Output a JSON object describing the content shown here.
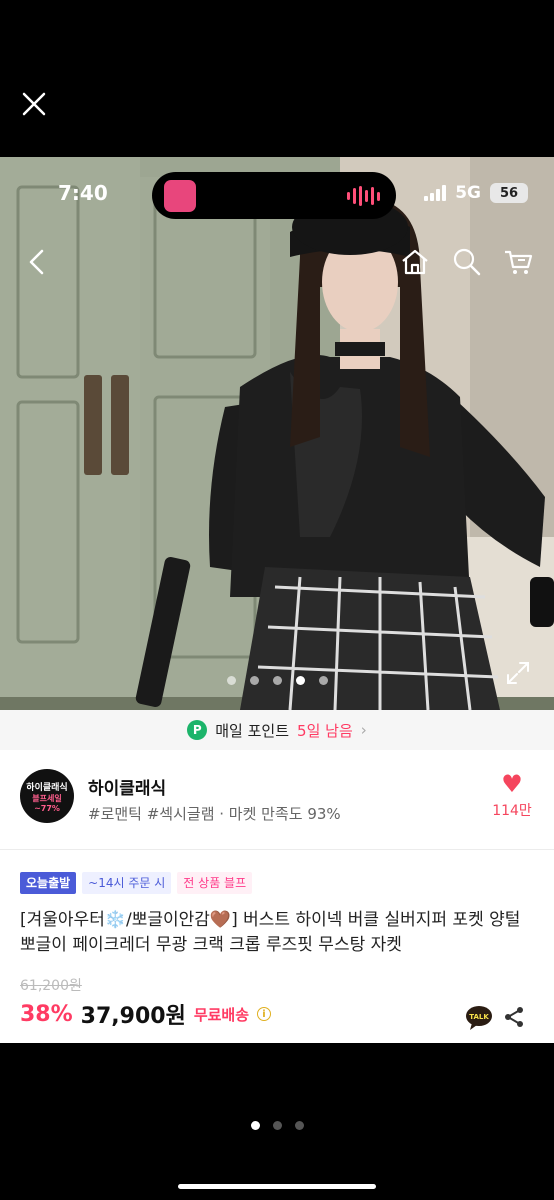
{
  "status_bar": {
    "time": "7:40",
    "network": "5G",
    "battery": "56"
  },
  "colors": {
    "brand_pink": "#ff3b63",
    "points_green": "#1cb46a",
    "badge_blue": "#4b5bd8"
  },
  "icons": {
    "close": "close-icon",
    "back": "chevron-left-icon",
    "home": "home-icon",
    "search": "search-icon",
    "cart": "cart-icon",
    "expand": "expand-icon",
    "heart": "heart-icon",
    "talk": "kakaotalk-icon",
    "share": "share-icon"
  },
  "photo": {
    "slide_count": 5,
    "active_slide": 4
  },
  "points_bar": {
    "icon_letter": "P",
    "label": "매일 포인트",
    "highlight": "5일 남음",
    "arrow": "›"
  },
  "seller": {
    "logo": {
      "line1": "하이클래식",
      "line2": "블프세일",
      "line3": "~77%"
    },
    "name": "하이클래식",
    "tags": "#로맨틱 #섹시글램 · 마켓 만족도 93%",
    "likes": "114만"
  },
  "product": {
    "badges": [
      "오늘출발",
      "~14시 주문 시",
      "전 상품 블프"
    ],
    "title": "[겨울아우터❄️/뽀글이안감🤎] 버스트 하이넥 버클 실버지퍼 포켓 양털 뽀글이 페이크레더 무광 크랙 크롭 루즈핏 무스탕 자켓",
    "original_price": "61,200원",
    "discount": "38%",
    "price": "37,900원",
    "shipping": "무료배송",
    "info": "i",
    "talk_label": "TALK"
  },
  "viewer": {
    "page_count": 3,
    "active_page": 1
  }
}
